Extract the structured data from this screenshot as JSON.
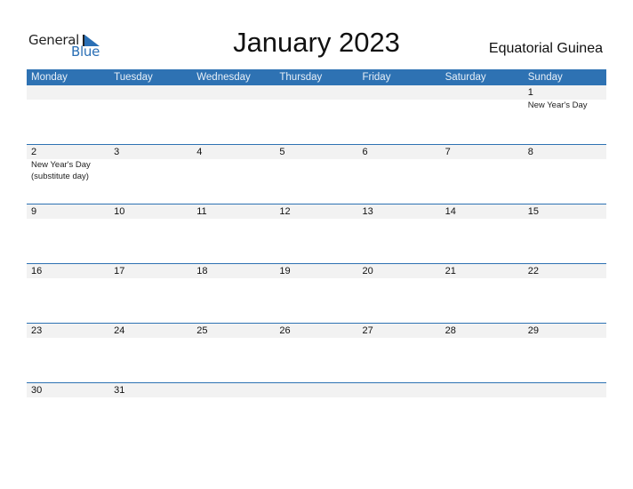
{
  "logo": {
    "general": "General",
    "blue": "Blue"
  },
  "title": "January 2023",
  "country": "Equatorial Guinea",
  "colors": {
    "accent": "#2e72b3",
    "band": "#f2f2f2"
  },
  "days": [
    "Monday",
    "Tuesday",
    "Wednesday",
    "Thursday",
    "Friday",
    "Saturday",
    "Sunday"
  ],
  "weeks": [
    [
      {
        "n": ""
      },
      {
        "n": ""
      },
      {
        "n": ""
      },
      {
        "n": ""
      },
      {
        "n": ""
      },
      {
        "n": ""
      },
      {
        "n": "1",
        "ev": [
          "New Year's Day"
        ]
      }
    ],
    [
      {
        "n": "2",
        "ev": [
          "New Year's Day",
          "(substitute day)"
        ]
      },
      {
        "n": "3"
      },
      {
        "n": "4"
      },
      {
        "n": "5"
      },
      {
        "n": "6"
      },
      {
        "n": "7"
      },
      {
        "n": "8"
      }
    ],
    [
      {
        "n": "9"
      },
      {
        "n": "10"
      },
      {
        "n": "11"
      },
      {
        "n": "12"
      },
      {
        "n": "13"
      },
      {
        "n": "14"
      },
      {
        "n": "15"
      }
    ],
    [
      {
        "n": "16"
      },
      {
        "n": "17"
      },
      {
        "n": "18"
      },
      {
        "n": "19"
      },
      {
        "n": "20"
      },
      {
        "n": "21"
      },
      {
        "n": "22"
      }
    ],
    [
      {
        "n": "23"
      },
      {
        "n": "24"
      },
      {
        "n": "25"
      },
      {
        "n": "26"
      },
      {
        "n": "27"
      },
      {
        "n": "28"
      },
      {
        "n": "29"
      }
    ],
    [
      {
        "n": "30"
      },
      {
        "n": "31"
      },
      {
        "n": ""
      },
      {
        "n": ""
      },
      {
        "n": ""
      },
      {
        "n": ""
      },
      {
        "n": ""
      }
    ]
  ]
}
